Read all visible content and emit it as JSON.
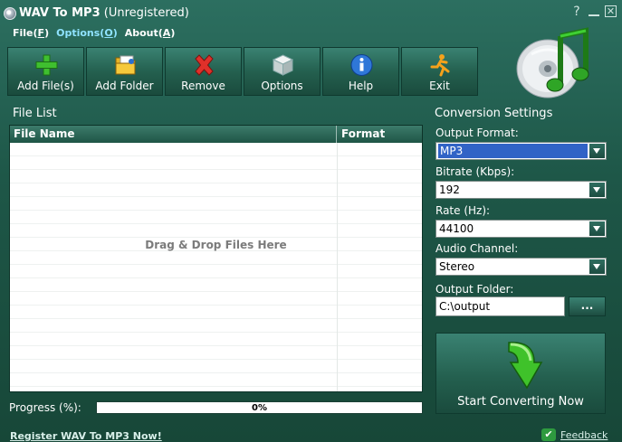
{
  "window": {
    "title_app": "WAV To MP3",
    "title_status": "(Unregistered)",
    "help_glyph": "?",
    "close_glyph": "✕"
  },
  "menu": [
    {
      "label": "File",
      "accel": "F"
    },
    {
      "label": "Options",
      "accel": "O"
    },
    {
      "label": "About",
      "accel": "A"
    }
  ],
  "toolbar": [
    {
      "label": "Add File(s)",
      "icon": "plus-icon"
    },
    {
      "label": "Add Folder",
      "icon": "folder-icon"
    },
    {
      "label": "Remove",
      "icon": "x-icon"
    },
    {
      "label": "Options",
      "icon": "cube-icon"
    },
    {
      "label": "Help",
      "icon": "info-icon"
    },
    {
      "label": "Exit",
      "icon": "running-man-icon"
    }
  ],
  "file_list": {
    "title": "File List",
    "col_name": "File Name",
    "col_format": "Format",
    "placeholder": "Drag & Drop Files Here"
  },
  "progress": {
    "label": "Progress (%):",
    "value": 0,
    "text": "0%"
  },
  "settings": {
    "title": "Conversion Settings",
    "output_format_label": "Output Format:",
    "output_format": "MP3",
    "bitrate_label": "Bitrate (Kbps):",
    "bitrate": "192",
    "rate_label": "Rate (Hz):",
    "rate": "44100",
    "channel_label": "Audio Channel:",
    "channel": "Stereo",
    "folder_label": "Output Folder:",
    "folder": "C:\\output",
    "browse_label": "...",
    "start_label": "Start Converting Now"
  },
  "footer": {
    "register_link": "Register WAV To MP3 Now!",
    "feedback_link": "Feedback"
  },
  "colors": {
    "background": "#1e5748",
    "accent_selected": "#3163c6",
    "progress_fill": "#2e8b57"
  }
}
